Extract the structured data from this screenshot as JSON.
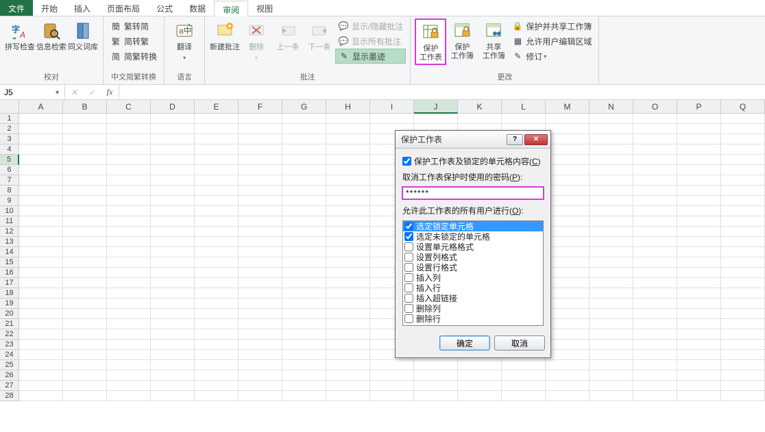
{
  "menu": {
    "file": "文件",
    "home": "开始",
    "insert": "插入",
    "layout": "页面布局",
    "formula": "公式",
    "data": "数据",
    "review": "审阅",
    "view": "视图"
  },
  "ribbon": {
    "proofing": {
      "label": "校对",
      "spell": "拼写检查",
      "research": "信息检索",
      "thesaurus": "同义词库"
    },
    "convert": {
      "label": "中文简繁转换",
      "t2s": "繁转简",
      "s2t": "简转繁",
      "st": "简繁转换"
    },
    "lang": {
      "label": "语言",
      "translate": "翻译"
    },
    "comments": {
      "label": "批注",
      "new": "新建批注",
      "del": "删除",
      "prev": "上一条",
      "next": "下一条",
      "showhide": "显示/隐藏批注",
      "showall": "显示所有批注",
      "ink": "显示墨迹"
    },
    "changes": {
      "label": "更改",
      "protect_sheet": "保护\n工作表",
      "protect_book": "保护\n工作簿",
      "share_book": "共享\n工作簿",
      "protect_share": "保护并共享工作簿",
      "allow_edit": "允许用户编辑区域",
      "track": "修订"
    }
  },
  "namebox": "J5",
  "cols": [
    "A",
    "B",
    "C",
    "D",
    "E",
    "F",
    "G",
    "H",
    "I",
    "J",
    "K",
    "L",
    "M",
    "N",
    "O",
    "P",
    "Q"
  ],
  "rows": 28,
  "active": {
    "col": "J",
    "row": 5,
    "selRow": 5
  },
  "dialog": {
    "title": "保护工作表",
    "chk_main": "保护工作表及锁定的单元格内容(",
    "chk_main_u": "C",
    "chk_main2": ")",
    "pwd_label": "取消工作表保护时使用的密码(",
    "pwd_u": "P",
    "pwd_label2": "):",
    "pwd_value": "******",
    "perm_label": "允许此工作表的所有用户进行(",
    "perm_u": "O",
    "perm_label2": "):",
    "items": [
      {
        "c": true,
        "sel": true,
        "t": "选定锁定单元格"
      },
      {
        "c": true,
        "t": "选定未锁定的单元格"
      },
      {
        "c": false,
        "t": "设置单元格格式"
      },
      {
        "c": false,
        "t": "设置列格式"
      },
      {
        "c": false,
        "t": "设置行格式"
      },
      {
        "c": false,
        "t": "插入列"
      },
      {
        "c": false,
        "t": "插入行"
      },
      {
        "c": false,
        "t": "插入超链接"
      },
      {
        "c": false,
        "t": "删除列"
      },
      {
        "c": false,
        "t": "删除行"
      }
    ],
    "ok": "确定",
    "cancel": "取消"
  }
}
